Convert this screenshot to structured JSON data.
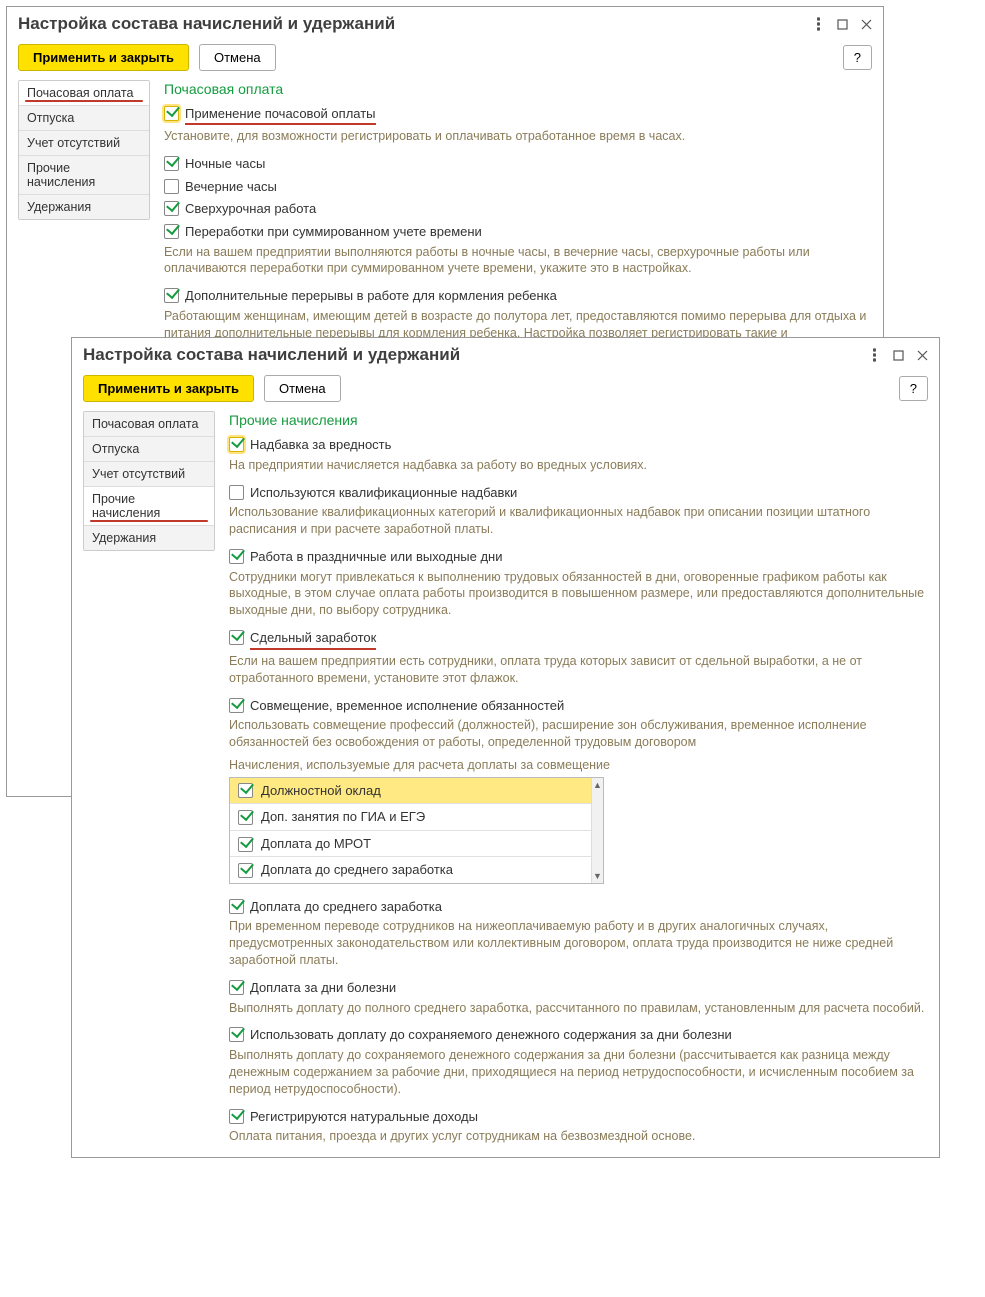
{
  "win1": {
    "title": "Настройка состава начислений и удержаний",
    "apply": "Применить и закрыть",
    "cancel": "Отмена",
    "help": "?",
    "tabs": [
      "Почасовая оплата",
      "Отпуска",
      "Учет отсутствий",
      "Прочие начисления",
      "Удержания"
    ],
    "section": "Почасовая оплата",
    "c1_label": "Применение почасовой оплаты",
    "c1_hint": "Установите, для возможности регистрировать и оплачивать отработанное время в часах.",
    "c2_label": "Ночные часы",
    "c3_label": "Вечерние часы",
    "c4_label": "Сверхурочная работа",
    "c5_label": "Переработки при суммированном учете времени",
    "c5_hint": "Если на вашем предприятии выполняются работы в ночные часы, в вечерние часы, сверхурочные работы или оплачиваются переработки при суммированном учете времени, укажите это в настройках.",
    "c6_label": "Дополнительные перерывы в работе для кормления ребенка",
    "c6_hint": "Работающим женщинам, имеющим детей в возрасте до полутора лет, предоставляются помимо перерыва для отдыха и питания дополнительные перерывы для кормления ребенка. Настройка позволяет регистрировать такие и автоматически оплачивать эти периоды по среднему."
  },
  "win2": {
    "title": "Настройка состава начислений и удержаний",
    "apply": "Применить и закрыть",
    "cancel": "Отмена",
    "help": "?",
    "tabs": [
      "Почасовая оплата",
      "Отпуска",
      "Учет отсутствий",
      "Прочие начисления",
      "Удержания"
    ],
    "section": "Прочие начисления",
    "d1_label": "Надбавка за вредность",
    "d1_hint": "На предприятии начисляется надбавка за работу во вредных условиях.",
    "d2_label": "Используются квалификационные надбавки",
    "d2_hint": "Использование квалификационных категорий и квалификационных надбавок при описании позиции штатного расписания и при расчете заработной платы.",
    "d3_label": "Работа в праздничные или выходные дни",
    "d3_hint": "Сотрудники могут привлекаться к выполнению трудовых обязанностей в дни, оговоренные графиком работы как выходные, в этом случае оплата работы производится в повышенном размере, или предоставляются дополнительные выходные дни, по выбору сотрудника.",
    "d4_label": "Сдельный заработок",
    "d4_hint": "Если на вашем предприятии есть сотрудники, оплата труда которых зависит от сдельной выработки, а не от отработанного времени, установите этот флажок.",
    "d5_label": "Совмещение, временное исполнение обязанностей",
    "d5_hint": "Использовать совмещение профессий (должностей), расширение зон обслуживания, временное исполнение обязанностей без освобождения от работы, определенной трудовым договором",
    "d5_sub": "Начисления, используемые для расчета доплаты за совмещение",
    "list": [
      "Должностной оклад",
      "Доп. занятия по ГИА и ЕГЭ",
      "Доплата до МРОТ",
      "Доплата до среднего заработка"
    ],
    "d6_label": "Доплата до среднего заработка",
    "d6_hint": "При временном переводе сотрудников на нижеоплачиваемую работу и в других аналогичных случаях, предусмотренных законодательством или коллективным договором, оплата труда производится не ниже средней заработной платы.",
    "d7_label": "Доплата за дни болезни",
    "d7_hint": "Выполнять доплату до полного среднего заработка, рассчитанного по правилам, установленным для расчета пособий.",
    "d8_label": "Использовать доплату до сохраняемого денежного содержания за дни болезни",
    "d8_hint": "Выполнять доплату до сохраняемого денежного содержания за дни болезни (рассчитывается как разница между денежным содержанием за рабочие дни, приходящиеся на период нетрудоспособности, и исчисленным пособием за период нетрудоспособности).",
    "d9_label": "Регистрируются натуральные доходы",
    "d9_hint": "Оплата питания, проезда и других услуг сотрудникам на безвозмездной основе."
  }
}
